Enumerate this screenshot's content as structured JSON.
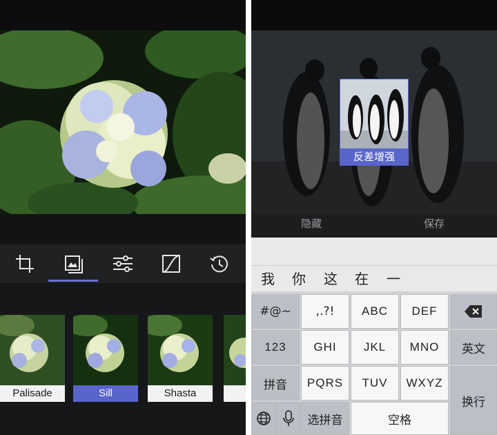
{
  "left": {
    "tools": [
      {
        "name": "crop-tool",
        "icon": "crop-icon"
      },
      {
        "name": "filters-tool",
        "icon": "filters-icon"
      },
      {
        "name": "adjust-tool",
        "icon": "sliders-icon"
      },
      {
        "name": "curves-tool",
        "icon": "curves-icon"
      },
      {
        "name": "history-tool",
        "icon": "history-icon"
      }
    ],
    "selected_tool": "filters-tool",
    "filters": [
      {
        "label": "Palisade"
      },
      {
        "label": "Sill"
      },
      {
        "label": "Shasta"
      }
    ],
    "selected_filter": "Sill",
    "accent_color": "#5a65cc"
  },
  "right": {
    "preview_label": "反差增强",
    "actions": {
      "hide": "隐藏",
      "save": "保存"
    },
    "keyboard": {
      "candidates": [
        "我",
        "你",
        "这",
        "在",
        "一"
      ],
      "rows": {
        "r1": [
          "#@~",
          ",.?!",
          "ABC",
          "DEF"
        ],
        "r2": [
          "123",
          "GHI",
          "JKL",
          "MNO"
        ],
        "r3": [
          "拼音",
          "PQRS",
          "TUV",
          "WXYZ"
        ]
      },
      "english": "英文",
      "newline": "换行",
      "pick_pinyin": "选拼音",
      "space": "空格"
    }
  }
}
